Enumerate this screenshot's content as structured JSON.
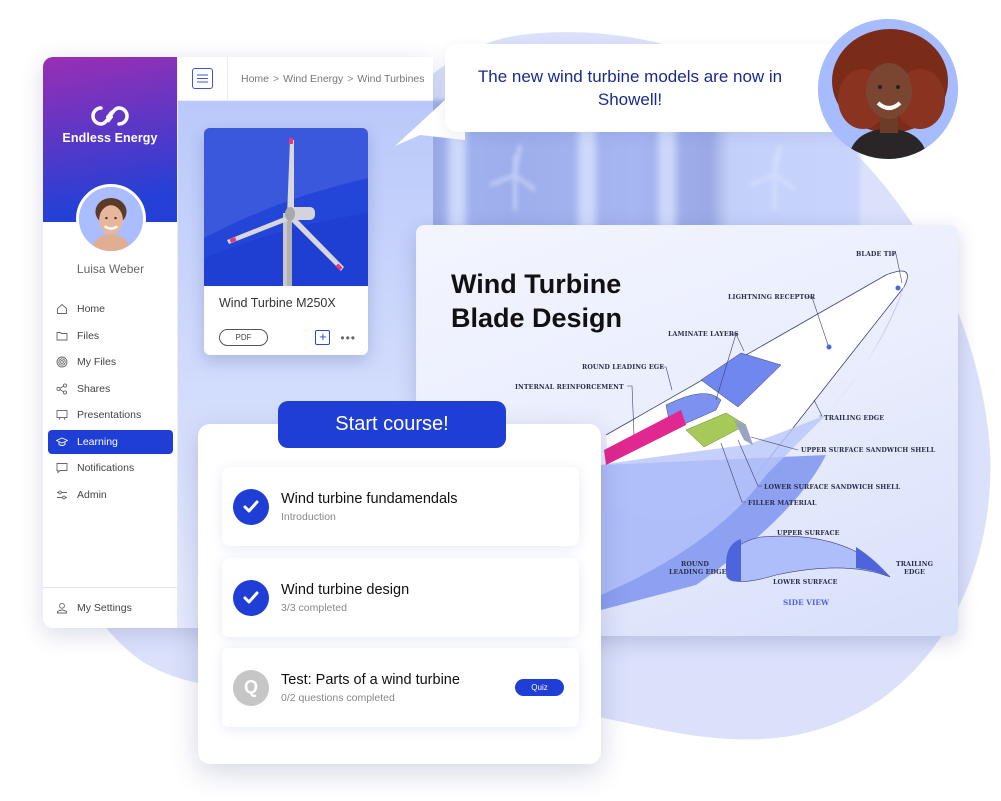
{
  "app": {
    "brand": "Endless Energy",
    "user_name": "Luisa Weber",
    "accent_color": "#1f3ed6"
  },
  "sidebar": {
    "items": [
      {
        "label": "Home",
        "icon": "home-icon",
        "active": false
      },
      {
        "label": "Files",
        "icon": "folder-icon",
        "active": false
      },
      {
        "label": "My Files",
        "icon": "fingerprint-icon",
        "active": false
      },
      {
        "label": "Shares",
        "icon": "share-icon",
        "active": false
      },
      {
        "label": "Presentations",
        "icon": "presentation-icon",
        "active": false
      },
      {
        "label": "Learning",
        "icon": "graduation-cap-icon",
        "active": true
      },
      {
        "label": "Notifications",
        "icon": "chat-bubble-icon",
        "active": false
      },
      {
        "label": "Admin",
        "icon": "sliders-icon",
        "active": false
      }
    ],
    "settings": {
      "label": "My Settings",
      "icon": "user-icon"
    }
  },
  "topbar": {
    "menu_icon": "hamburger-menu-icon",
    "breadcrumb": [
      "Home",
      "Wind Energy",
      "Wind Turbines"
    ],
    "separator": ">"
  },
  "file_card": {
    "title": "Wind Turbine M250X",
    "type_tag": "PDF",
    "add_label": "+",
    "more_label": "•••"
  },
  "bubble": {
    "message": "The new wind turbine models are now in Showell!"
  },
  "diagram": {
    "title_line1": "Wind Turbine",
    "title_line2": "Blade Design",
    "labels": {
      "blade_tip": "BLADE TIP",
      "lightning_receptor": "LIGHTNING RECEPTOR",
      "laminate_layers": "LAMINATE LAYERS",
      "round_leading_edge_top": "ROUND LEADING EGE",
      "internal_reinforcement": "INTERNAL REINFORCEMENT",
      "trailing_edge": "TRAILING EDGE",
      "upper_surface_sandwich_shell": "UPPER SURFACE SANDWICH SHELL",
      "lower_surface_sandwich_shell": "LOWER SURFACE SANDWICH SHELL",
      "filler_material": "FILLER MATERIAL",
      "upper_surface": "UPPER SURFACE",
      "lower_surface": "LOWER SURFACE",
      "round_1": "ROUND",
      "leading_edge_2": "LEADING EDGE",
      "trailing_1": "TRAILING",
      "edge_2": "EDGE",
      "side_view": "SIDE VIEW"
    }
  },
  "course": {
    "start_label": "Start course!",
    "lessons": [
      {
        "title": "Wind turbine fundamendals",
        "subtitle": "Introduction",
        "status": "completed"
      },
      {
        "title": "Wind turbine design",
        "subtitle": "3/3 completed",
        "status": "completed"
      },
      {
        "title": "Test: Parts of a wind turbine",
        "subtitle": "0/2 questions completed",
        "status": "quiz",
        "icon_letter": "Q",
        "badge": "Quiz"
      }
    ]
  }
}
